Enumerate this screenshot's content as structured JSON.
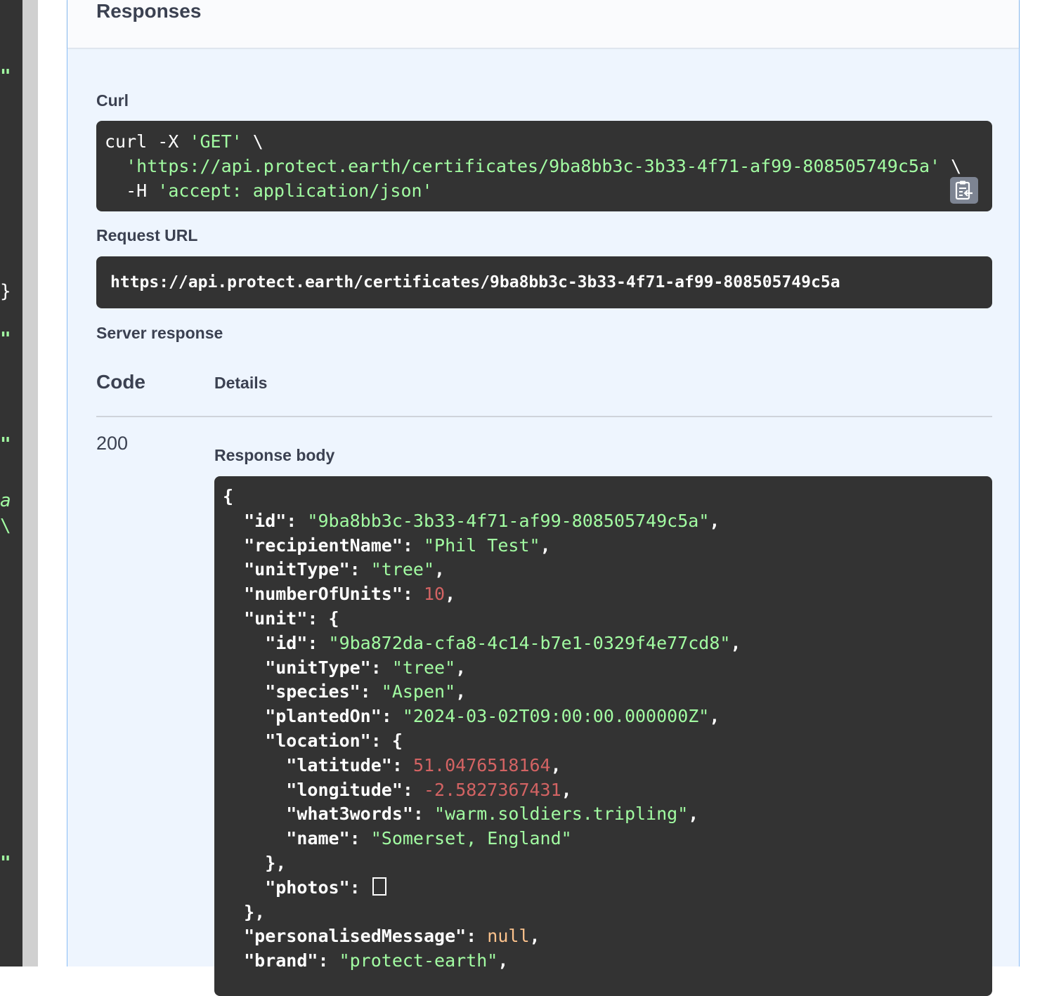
{
  "editor_fragments": [
    "\"",
    "}",
    "\"",
    "\"",
    "a",
    "\\",
    "\""
  ],
  "panel": {
    "title": "Responses",
    "curl": {
      "label": "Curl",
      "line1_cmd": "curl -X ",
      "line1_method": "'GET'",
      "line1_end": " \\",
      "line2_url": "'https://api.protect.earth/certificates/9ba8bb3c-3b33-4f71-af99-808505749c5a'",
      "line2_end": " \\",
      "line3_flag": "-H ",
      "line3_header": "'accept: application/json'",
      "copy_icon": "clipboard-copy-icon"
    },
    "request_url": {
      "label": "Request URL",
      "value": "https://api.protect.earth/certificates/9ba8bb3c-3b33-4f71-af99-808505749c5a"
    },
    "server_response": {
      "label": "Server response",
      "col_code": "Code",
      "col_details": "Details",
      "status": "200",
      "body_label": "Response body"
    }
  },
  "response_body": {
    "id": "\"9ba8bb3c-3b33-4f71-af99-808505749c5a\"",
    "recipientName": "\"Phil Test\"",
    "unitType": "\"tree\"",
    "numberOfUnits": "10",
    "unit": {
      "id": "\"9ba872da-cfa8-4c14-b7e1-0329f4e77cd8\"",
      "unitType": "\"tree\"",
      "species": "\"Aspen\"",
      "plantedOn": "\"2024-03-02T09:00:00.000000Z\"",
      "location": {
        "latitude": "51.0476518164",
        "longitude": "-2.5827367431",
        "what3words": "\"warm.soldiers.tripling\"",
        "name": "\"Somerset, England\""
      }
    },
    "personalisedMessage": "null",
    "brand": "\"protect-earth\""
  },
  "colors": {
    "code_bg": "#333333",
    "string": "#a2fca2",
    "number": "#d36363",
    "null": "#fcc28c",
    "panel_bg": "#eef5fe",
    "panel_border": "#89bdf6"
  }
}
